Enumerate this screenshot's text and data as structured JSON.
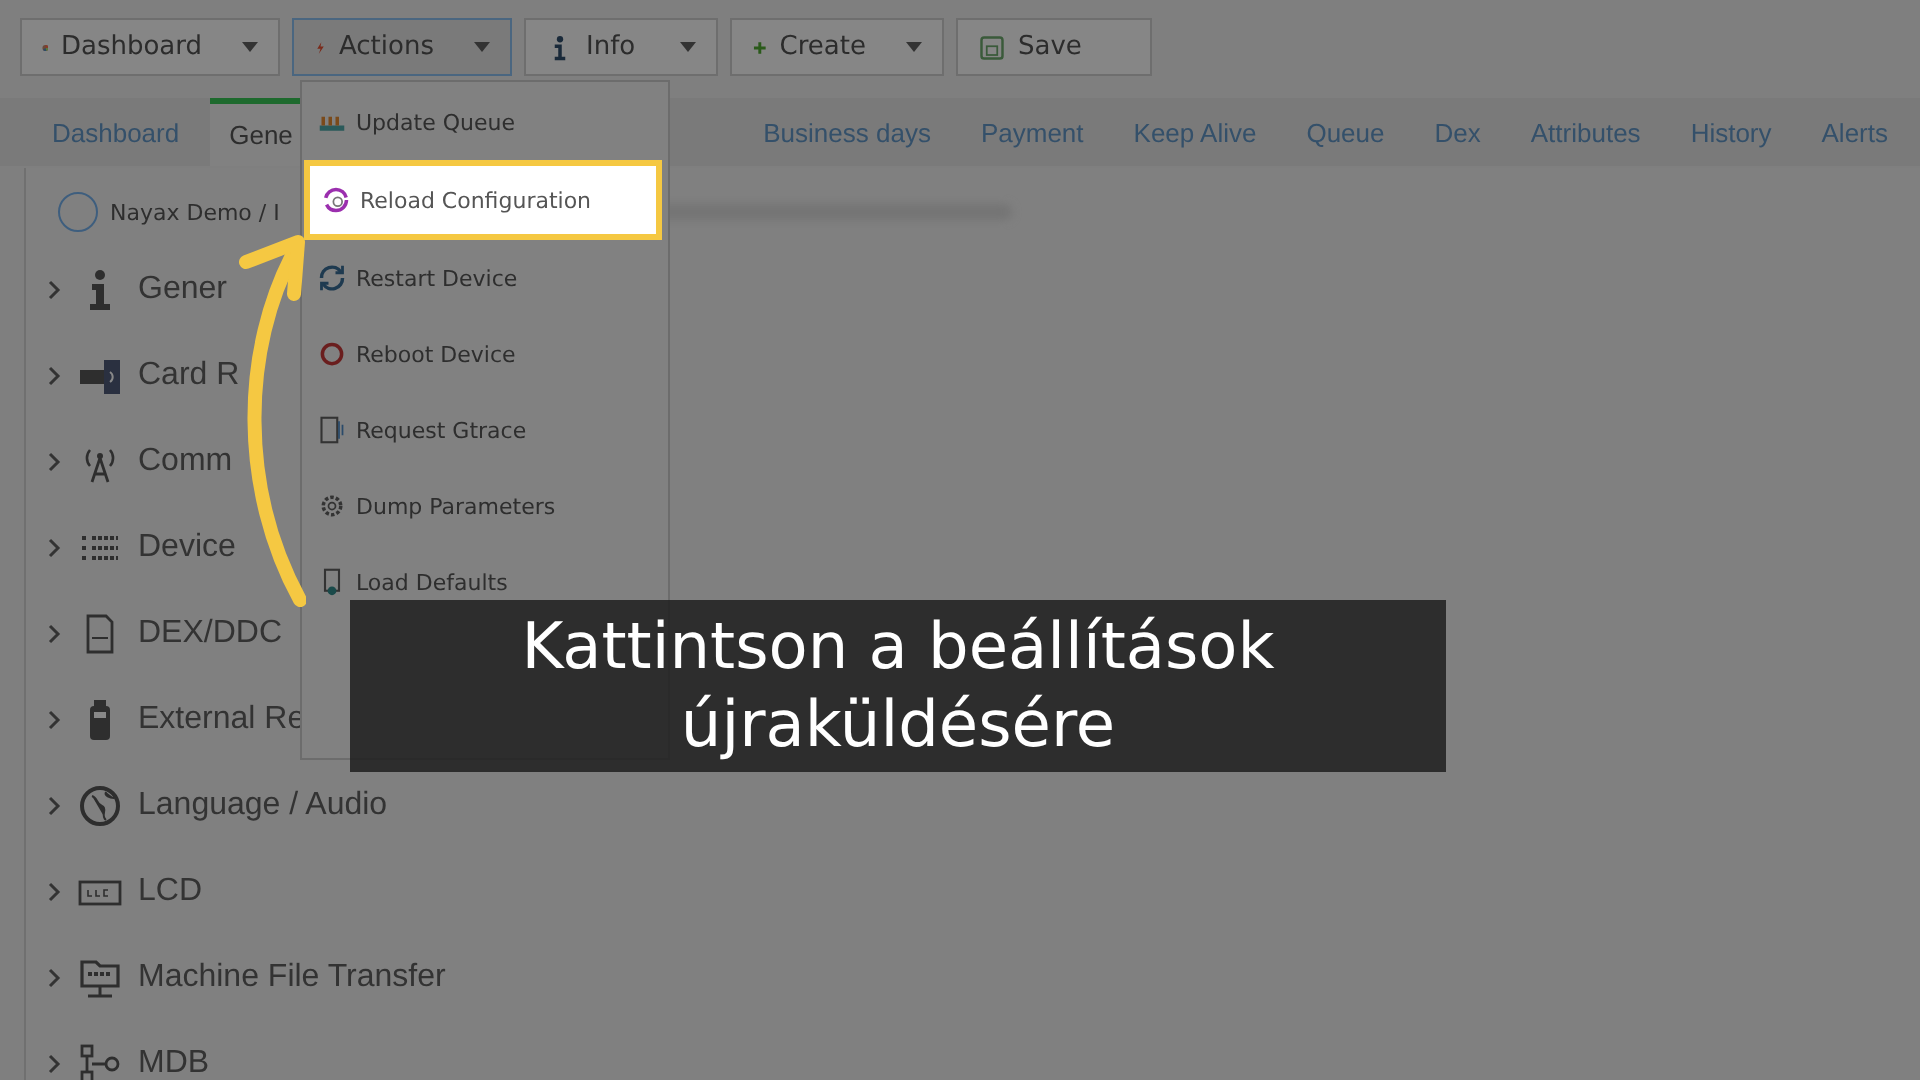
{
  "toolbar": [
    {
      "label": "Dashboard",
      "selected": false,
      "dropdown": true
    },
    {
      "label": "Actions",
      "selected": true,
      "dropdown": true
    },
    {
      "label": "Info",
      "selected": false,
      "dropdown": true
    },
    {
      "label": "Create",
      "selected": false,
      "dropdown": true
    },
    {
      "label": "Save",
      "selected": false,
      "dropdown": false
    }
  ],
  "tabs": [
    {
      "label": "Dashboard",
      "selected": false
    },
    {
      "label": "Gene",
      "selected": true
    },
    {
      "label": "Business days",
      "selected": false
    },
    {
      "label": "Payment",
      "selected": false
    },
    {
      "label": "Keep Alive",
      "selected": false
    },
    {
      "label": "Queue",
      "selected": false
    },
    {
      "label": "Dex",
      "selected": false
    },
    {
      "label": "Attributes",
      "selected": false
    },
    {
      "label": "History",
      "selected": false
    },
    {
      "label": "Alerts",
      "selected": false
    }
  ],
  "breadcrumb": "Nayax Demo / I",
  "tree": [
    {
      "label": "Gener"
    },
    {
      "label": "Card R"
    },
    {
      "label": "Comm"
    },
    {
      "label": "Device"
    },
    {
      "label": "DEX/DDC"
    },
    {
      "label": "External Re"
    },
    {
      "label": "Language / Audio"
    },
    {
      "label": "LCD"
    },
    {
      "label": "Machine File Transfer"
    },
    {
      "label": "MDB"
    }
  ],
  "actions_menu": [
    {
      "label": "Update Queue",
      "highlighted": false
    },
    {
      "label": "Reload Configuration",
      "highlighted": true
    },
    {
      "label": "Restart Device",
      "highlighted": false
    },
    {
      "label": "Reboot Device",
      "highlighted": false
    },
    {
      "label": "Request Gtrace",
      "highlighted": false
    },
    {
      "label": "Dump Parameters",
      "highlighted": false
    },
    {
      "label": "Load Defaults",
      "highlighted": false
    }
  ],
  "caption": "Kattintson a beállítások újraküldésére"
}
